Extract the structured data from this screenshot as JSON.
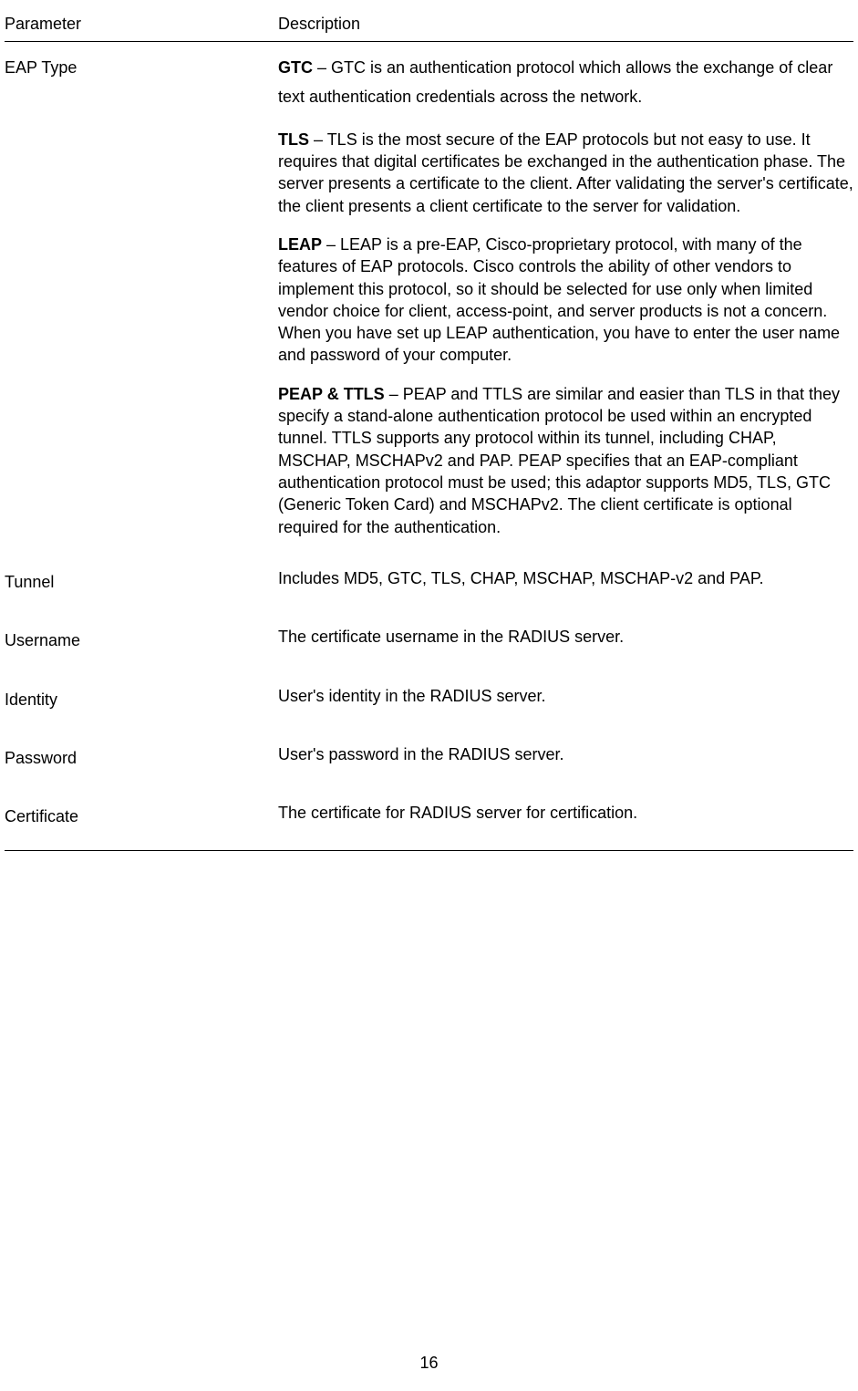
{
  "headers": {
    "parameter": "Parameter",
    "description": "Description"
  },
  "rows": {
    "eap_type": {
      "label": "EAP Type",
      "gtc_bold": "GTC",
      "gtc_text": " – GTC is an authentication protocol which allows the exchange of clear text authentication credentials across the network.",
      "tls_bold": "TLS",
      "tls_text": " – TLS is the most secure of the EAP protocols but not easy to use. It requires that digital certificates be exchanged in the authentication phase. The server presents a certificate to the client. After validating the server's certificate, the client presents a client certificate to the server for validation.",
      "leap_bold": "LEAP",
      "leap_text": " – LEAP is a pre-EAP, Cisco-proprietary protocol, with many of the features of EAP protocols. Cisco controls the ability of other vendors to implement this protocol, so it should be selected for use only when limited vendor choice for client, access-point, and server products is not a concern. When you have set up LEAP authentication, you have to enter the user name and password of your computer.",
      "peap_bold": "PEAP & TTLS",
      "peap_text": " – PEAP and TTLS are similar and easier than TLS in that they specify a stand-alone authentication protocol be used within an encrypted tunnel. TTLS supports any protocol within its tunnel, including CHAP, MSCHAP, MSCHAPv2 and PAP. PEAP specifies that an EAP-compliant authentication protocol must be used; this adaptor supports MD5, TLS, GTC (Generic Token Card) and MSCHAPv2. The client certificate is optional required for the authentication."
    },
    "tunnel": {
      "label": "Tunnel",
      "desc": "Includes MD5, GTC, TLS, CHAP, MSCHAP, MSCHAP-v2 and PAP."
    },
    "username": {
      "label": "Username",
      "desc": "The certificate username in the RADIUS server."
    },
    "identity": {
      "label": "Identity",
      "desc": "User's identity in the RADIUS server."
    },
    "password": {
      "label": "Password",
      "desc": "User's password in the RADIUS server."
    },
    "certificate": {
      "label": "Certificate",
      "desc": "The certificate for RADIUS server for certification."
    }
  },
  "page_number": "16"
}
